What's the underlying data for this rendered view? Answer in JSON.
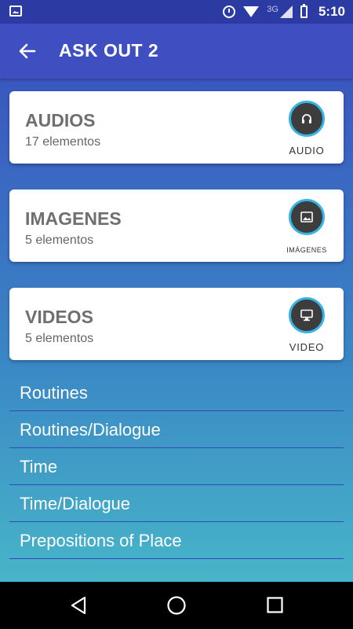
{
  "status_bar": {
    "network": "3G",
    "time": "5:10"
  },
  "app_bar": {
    "title": "ASK OUT 2"
  },
  "cards": [
    {
      "title": "AUDIOS",
      "count": "17 elementos",
      "icon_label": "AUDIO",
      "icon": "headphones-icon"
    },
    {
      "title": "IMAGENES",
      "count": "5 elementos",
      "icon_label": "IMÁGENES",
      "icon": "image-icon"
    },
    {
      "title": "VIDEOS",
      "count": "5 elementos",
      "icon_label": "VIDEO",
      "icon": "monitor-icon"
    }
  ],
  "list": [
    {
      "label": "Routines"
    },
    {
      "label": "Routines/Dialogue"
    },
    {
      "label": "Time"
    },
    {
      "label": "Time/Dialogue"
    },
    {
      "label": "Prepositions of Place"
    }
  ],
  "colors": {
    "app_bar": "#3f4fc1",
    "status_bar": "#2c3aa3",
    "icon_ring": "#37b4e6",
    "icon_fill": "#3d3d3d"
  }
}
